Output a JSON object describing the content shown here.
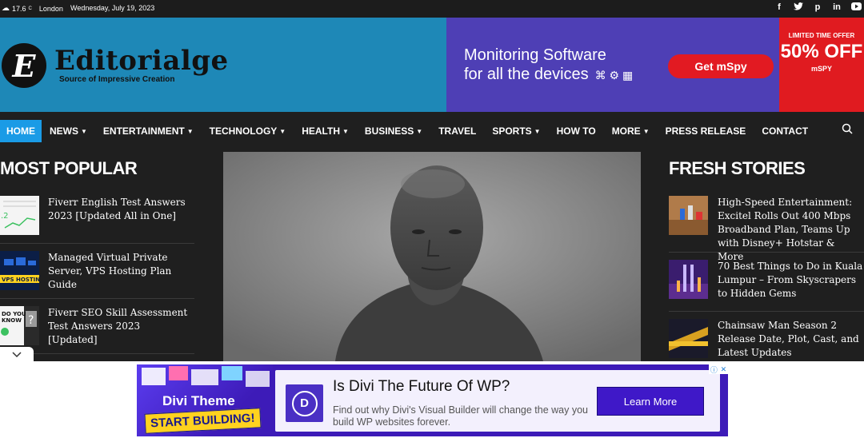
{
  "topbar": {
    "weather_temp": "17.6",
    "weather_unit": "C",
    "city": "London",
    "date": "Wednesday, July 19, 2023",
    "social_icons": [
      "facebook-icon",
      "twitter-icon",
      "pinterest-icon",
      "linkedin-icon",
      "youtube-icon"
    ]
  },
  "header": {
    "logo_letter": "E",
    "logo_title": "Editorialge",
    "logo_tagline": "Source of Impressive Creation",
    "bg_color": "#1e88b7"
  },
  "ad_banner": {
    "line1": "Monitoring Software",
    "line2": "for all the devices",
    "button": "Get mSpy",
    "offer_label": "LIMITED TIME OFFER",
    "offer_value": "50% OFF",
    "brand": "mSPY"
  },
  "nav": {
    "items": [
      {
        "label": "HOME",
        "dropdown": false,
        "active": true
      },
      {
        "label": "NEWS",
        "dropdown": true
      },
      {
        "label": "ENTERTAINMENT",
        "dropdown": true
      },
      {
        "label": "TECHNOLOGY",
        "dropdown": true
      },
      {
        "label": "HEALTH",
        "dropdown": true
      },
      {
        "label": "BUSINESS",
        "dropdown": true
      },
      {
        "label": "TRAVEL",
        "dropdown": false
      },
      {
        "label": "SPORTS",
        "dropdown": true
      },
      {
        "label": "HOW TO",
        "dropdown": false
      },
      {
        "label": "MORE",
        "dropdown": true
      },
      {
        "label": "PRESS RELEASE",
        "dropdown": false
      },
      {
        "label": "CONTACT",
        "dropdown": false
      }
    ],
    "active_color": "#1a9be6"
  },
  "most_popular": {
    "title": "MOST POPULAR",
    "items": [
      {
        "title": "Fiverr English Test Answers 2023 [Updated All in One]"
      },
      {
        "title": "Managed Virtual Private Server, VPS Hosting Plan Guide"
      },
      {
        "title": "Fiverr SEO Skill Assessment Test Answers 2023 [Updated]"
      }
    ]
  },
  "fresh_stories": {
    "title": "FRESH STORIES",
    "items": [
      {
        "title": "High-Speed Entertainment: Excitel Rolls Out 400 Mbps Broadband Plan, Teams Up with Disney+ Hotstar & More"
      },
      {
        "title": "70 Best Things to Do in Kuala Lumpur – From Skyscrapers to Hidden Gems"
      },
      {
        "title": "Chainsaw Man Season 2 Release Date, Plot, Cast, and Latest Updates"
      }
    ]
  },
  "bottom_ad": {
    "left_title": "Divi Theme",
    "left_cta": "START BUILDING!",
    "headline": "Is Divi The Future Of WP?",
    "subtext": "Find out why Divi's Visual Builder will change the way you build WP websites forever.",
    "button": "Learn More",
    "logo_letter": "D"
  }
}
